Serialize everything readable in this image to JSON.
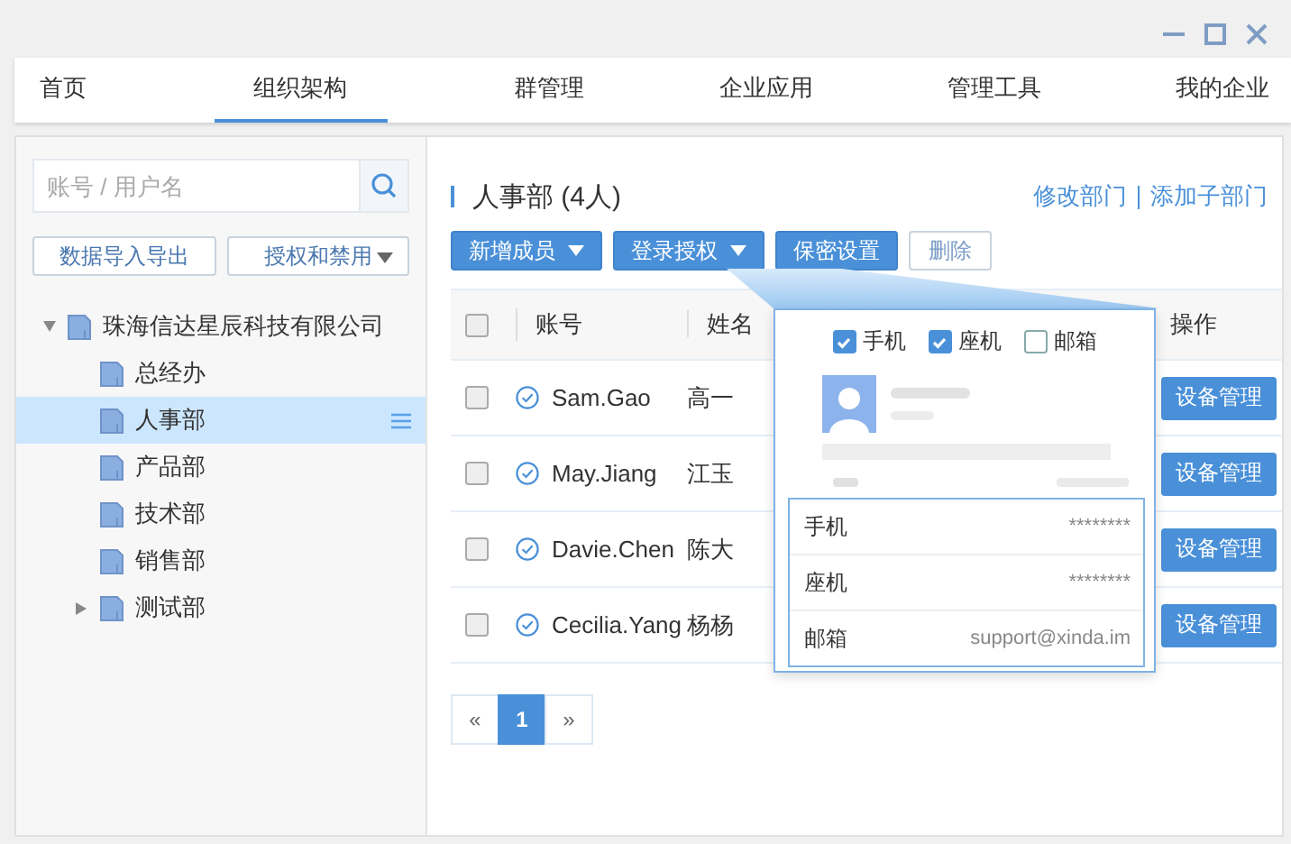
{
  "tabs": [
    {
      "label": "首页",
      "selected": false
    },
    {
      "label": "组织架构",
      "selected": true
    },
    {
      "label": "群管理",
      "selected": false
    },
    {
      "label": "企业应用",
      "selected": false
    },
    {
      "label": "管理工具",
      "selected": false
    },
    {
      "label": "我的企业",
      "selected": false
    }
  ],
  "sidebar": {
    "search": {
      "placeholder": "账号 / 用户名"
    },
    "buttons": [
      {
        "label": "数据导入导出",
        "kind": "plain"
      },
      {
        "label": "授权和禁用",
        "kind": "dropdown"
      }
    ],
    "tree": [
      {
        "label": "珠海信达星辰科技有限公司",
        "selected": false,
        "expanded": true,
        "children": [
          {
            "label": "总经办",
            "selected": false
          },
          {
            "label": "人事部",
            "selected": true
          },
          {
            "label": "产品部",
            "selected": false
          },
          {
            "label": "技术部",
            "selected": false
          },
          {
            "label": "销售部",
            "selected": false
          },
          {
            "label": "测试部",
            "selected": false,
            "expanded": false
          }
        ]
      }
    ]
  },
  "panel": {
    "title": "人事部 (4人)",
    "links": [
      "修改部门",
      "添加子部门"
    ],
    "toolbar": [
      {
        "label": "新增成员",
        "kind": "dropdown"
      },
      {
        "label": "登录授权",
        "kind": "dropdown"
      },
      {
        "label": "保密设置",
        "kind": "primary"
      },
      {
        "label": "删除",
        "kind": "outline"
      }
    ],
    "table": {
      "columns": [
        "账号",
        "姓名",
        "操作"
      ],
      "header_checked": false,
      "rows": [
        {
          "checked": false,
          "verified": true,
          "account": "Sam.Gao",
          "name": "高一",
          "action": "设备管理"
        },
        {
          "checked": false,
          "verified": true,
          "account": "May.Jiang",
          "name": "江玉",
          "action": "设备管理"
        },
        {
          "checked": false,
          "verified": true,
          "account": "Davie.Chen",
          "name": "陈大",
          "action": "设备管理"
        },
        {
          "checked": false,
          "verified": true,
          "account": "Cecilia.Yang",
          "name": "杨杨",
          "action": "设备管理"
        }
      ]
    },
    "pagination": {
      "prev": "«",
      "pages": [
        {
          "label": "1",
          "selected": true
        }
      ],
      "next": "»"
    }
  },
  "popover": {
    "options": [
      {
        "label": "手机",
        "checked": true
      },
      {
        "label": "座机",
        "checked": true
      },
      {
        "label": "邮箱",
        "checked": false
      }
    ],
    "fields": [
      {
        "label": "手机",
        "value": "********"
      },
      {
        "label": "座机",
        "value": "********"
      },
      {
        "label": "邮箱",
        "value": "support@xinda.im"
      }
    ]
  }
}
